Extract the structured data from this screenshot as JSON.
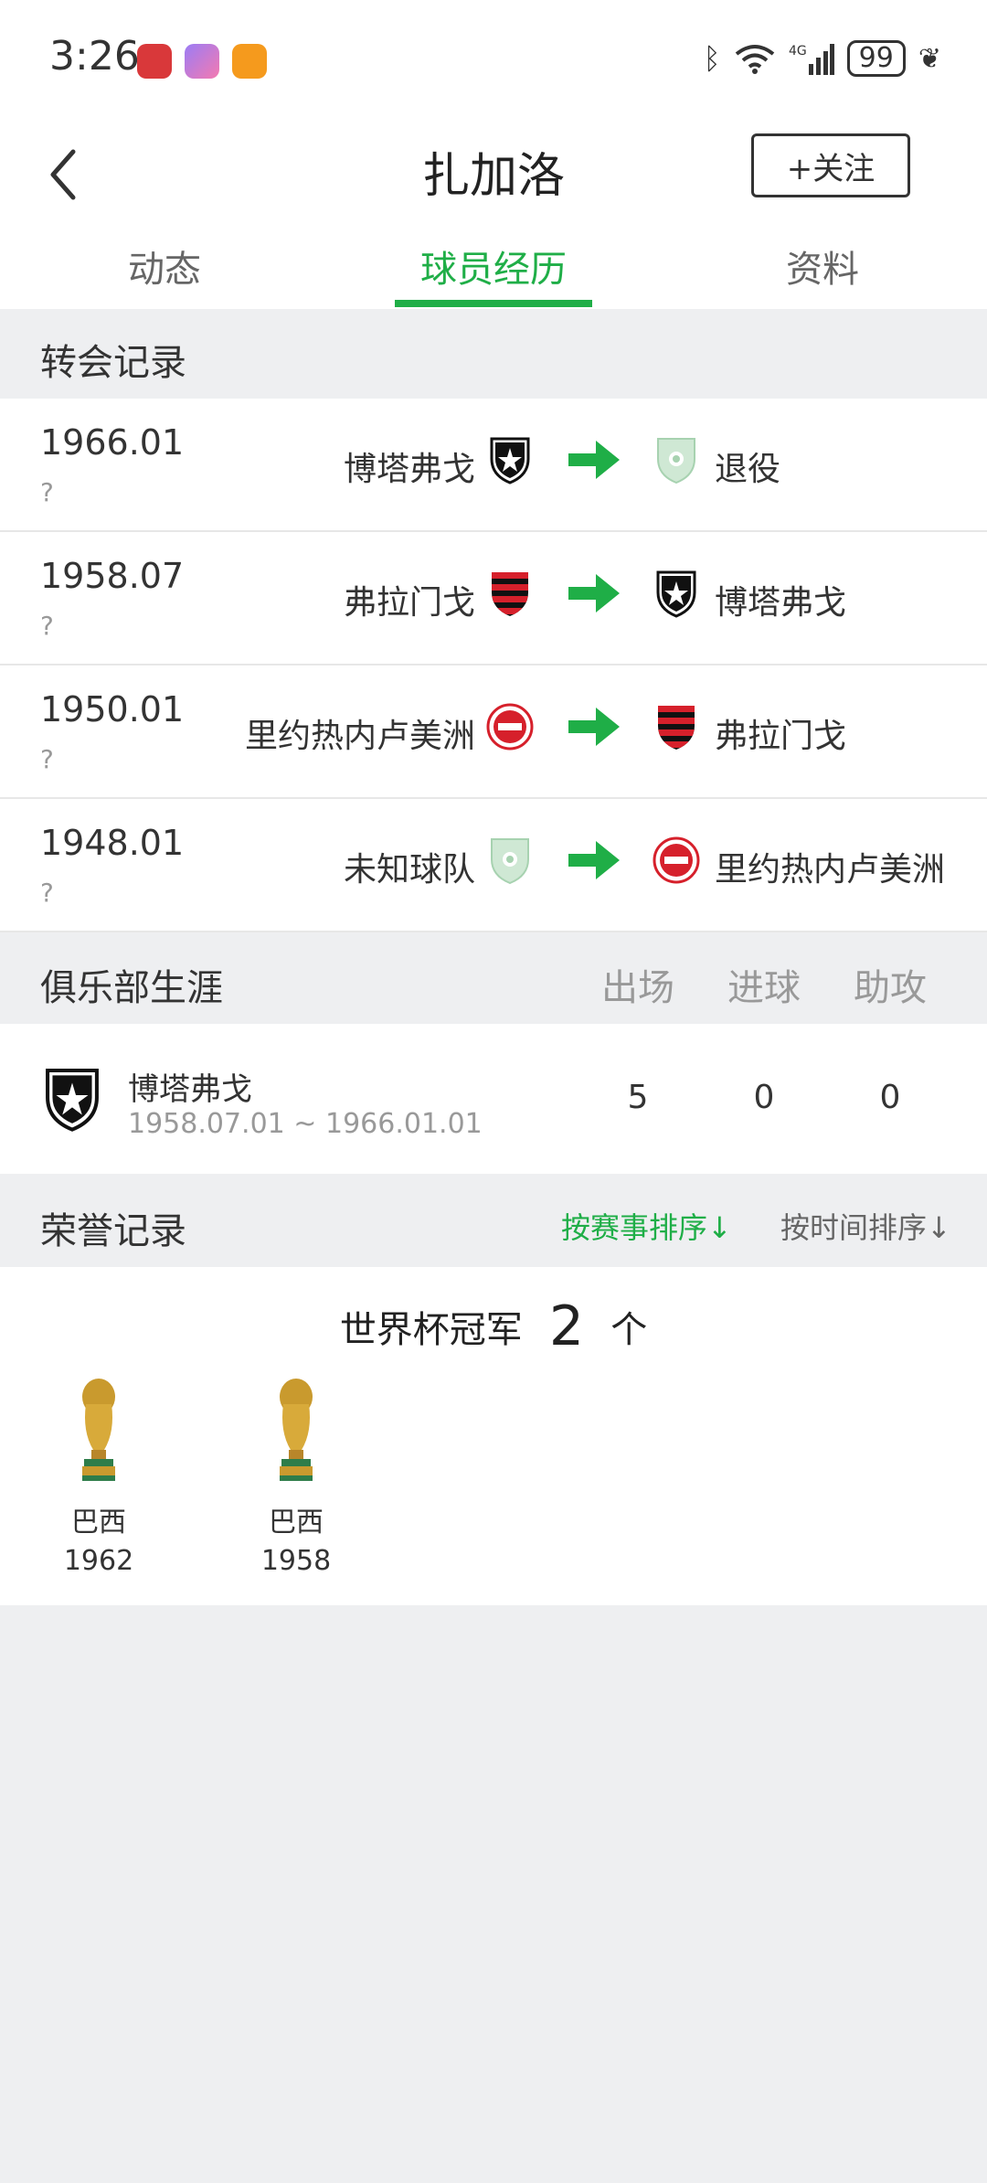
{
  "status_bar": {
    "time": "3:26",
    "battery": "99"
  },
  "header": {
    "title": "扎加洛",
    "follow_label": "+关注"
  },
  "tabs": [
    {
      "label": "动态",
      "active": false
    },
    {
      "label": "球员经历",
      "active": true
    },
    {
      "label": "资料",
      "active": false
    }
  ],
  "transfers": {
    "section_title": "转会记录",
    "rows": [
      {
        "date": "1966.01",
        "fee": "?",
        "from": "博塔弗戈",
        "to": "退役"
      },
      {
        "date": "1958.07",
        "fee": "?",
        "from": "弗拉门戈",
        "to": "博塔弗戈"
      },
      {
        "date": "1950.01",
        "fee": "?",
        "from": "里约热内卢美洲",
        "to": "弗拉门戈"
      },
      {
        "date": "1948.01",
        "fee": "?",
        "from": "未知球队",
        "to": "里约热内卢美洲"
      }
    ]
  },
  "club_career": {
    "section_title": "俱乐部生涯",
    "columns": [
      "出场",
      "进球",
      "助攻"
    ],
    "clubs": [
      {
        "name": "博塔弗戈",
        "range": "1958.07.01 ~ 1966.01.01",
        "apps": "5",
        "goals": "0",
        "assists": "0"
      }
    ]
  },
  "honors": {
    "section_title": "荣誉记录",
    "sort_by_event": "按赛事排序↓",
    "sort_by_time": "按时间排序↓",
    "group_title": "世界杯冠军",
    "count": "2",
    "unit": "个",
    "items": [
      {
        "team": "巴西",
        "year": "1962"
      },
      {
        "team": "巴西",
        "year": "1958"
      }
    ]
  },
  "colors": {
    "accent": "#1fae47",
    "background": "#eeeff1"
  }
}
